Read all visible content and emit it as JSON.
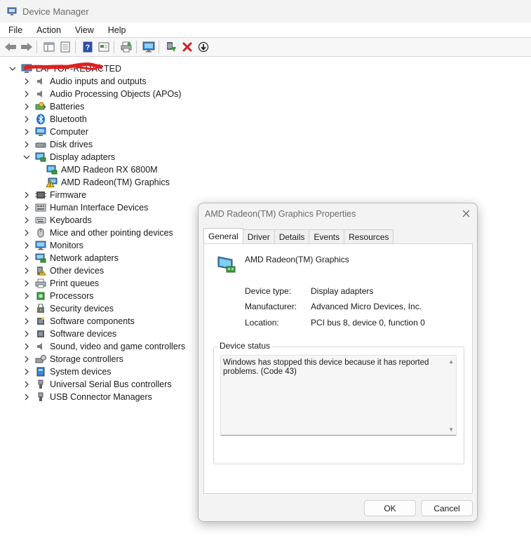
{
  "window": {
    "title": "Device Manager"
  },
  "menu": [
    "File",
    "Action",
    "View",
    "Help"
  ],
  "toolbar": {
    "icons": [
      "back-icon",
      "forward-icon",
      "properties-pane-icon",
      "show-hidden-icon",
      "help-icon",
      "view-icon",
      "print-icon",
      "monitor-icon",
      "update-driver-icon",
      "uninstall-icon",
      "disable-device-icon"
    ]
  },
  "tree": {
    "root": "LAPTOP-REDACTED",
    "categories": [
      {
        "label": "Audio inputs and outputs",
        "icon": "speaker-icon",
        "expanded": false
      },
      {
        "label": "Audio Processing Objects (APOs)",
        "icon": "speaker-icon",
        "expanded": false
      },
      {
        "label": "Batteries",
        "icon": "battery-icon",
        "expanded": false
      },
      {
        "label": "Bluetooth",
        "icon": "bluetooth-icon",
        "expanded": false
      },
      {
        "label": "Computer",
        "icon": "computer-icon",
        "expanded": false
      },
      {
        "label": "Disk drives",
        "icon": "disk-drive-icon",
        "expanded": false
      },
      {
        "label": "Display adapters",
        "icon": "display-adapter-icon",
        "expanded": true
      },
      {
        "label": "Firmware",
        "icon": "firmware-icon",
        "expanded": false
      },
      {
        "label": "Human Interface Devices",
        "icon": "hid-icon",
        "expanded": false
      },
      {
        "label": "Keyboards",
        "icon": "keyboard-icon",
        "expanded": false
      },
      {
        "label": "Mice and other pointing devices",
        "icon": "mouse-icon",
        "expanded": false
      },
      {
        "label": "Monitors",
        "icon": "monitor-icon",
        "expanded": false
      },
      {
        "label": "Network adapters",
        "icon": "network-adapter-icon",
        "expanded": false
      },
      {
        "label": "Other devices",
        "icon": "other-devices-icon",
        "expanded": false
      },
      {
        "label": "Print queues",
        "icon": "printer-icon",
        "expanded": false
      },
      {
        "label": "Processors",
        "icon": "processor-icon",
        "expanded": false
      },
      {
        "label": "Security devices",
        "icon": "security-device-icon",
        "expanded": false
      },
      {
        "label": "Software components",
        "icon": "software-component-icon",
        "expanded": false
      },
      {
        "label": "Software devices",
        "icon": "software-device-icon",
        "expanded": false
      },
      {
        "label": "Sound, video and game controllers",
        "icon": "speaker-icon",
        "expanded": false
      },
      {
        "label": "Storage controllers",
        "icon": "storage-controller-icon",
        "expanded": false
      },
      {
        "label": "System devices",
        "icon": "system-device-icon",
        "expanded": false
      },
      {
        "label": "Universal Serial Bus controllers",
        "icon": "usb-icon",
        "expanded": false
      },
      {
        "label": "USB Connector Managers",
        "icon": "usb-icon",
        "expanded": false
      }
    ],
    "display_children": [
      {
        "label": "AMD Radeon RX 6800M",
        "icon": "display-adapter-icon",
        "warning": false
      },
      {
        "label": "AMD Radeon(TM) Graphics",
        "icon": "display-adapter-icon",
        "warning": true
      }
    ]
  },
  "dialog": {
    "title": "AMD Radeon(TM) Graphics Properties",
    "tabs": [
      "General",
      "Driver",
      "Details",
      "Events",
      "Resources"
    ],
    "active_tab": "General",
    "device_name": "AMD Radeon(TM) Graphics",
    "props": [
      {
        "key": "Device type:",
        "value": "Display adapters"
      },
      {
        "key": "Manufacturer:",
        "value": "Advanced Micro Devices, Inc."
      },
      {
        "key": "Location:",
        "value": "PCI bus 8, device 0, function 0"
      }
    ],
    "status_label": "Device status",
    "status_text": "Windows has stopped this device because it has reported problems. (Code 43)",
    "ok_label": "OK",
    "cancel_label": "Cancel"
  }
}
